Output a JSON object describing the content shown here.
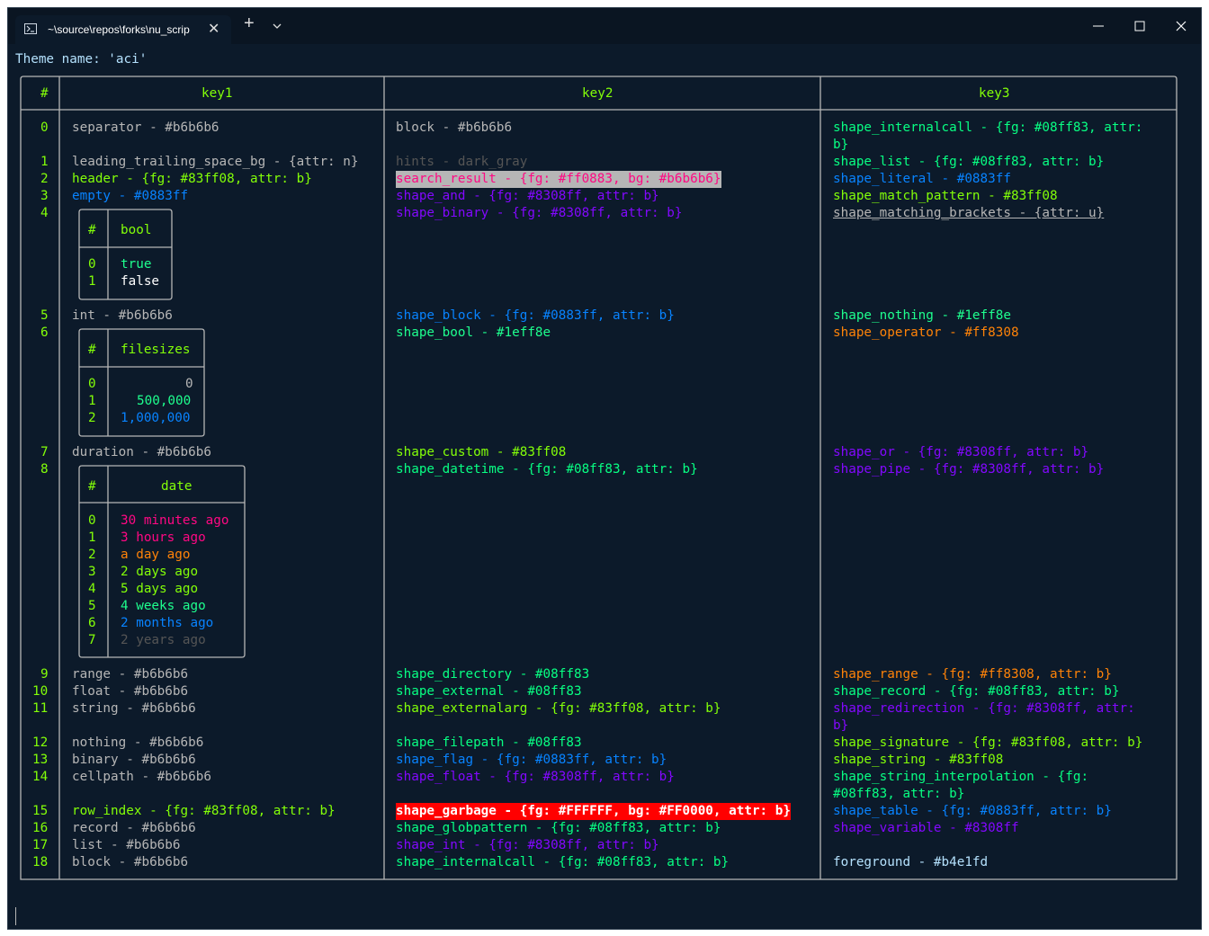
{
  "tab": {
    "title": "~\\source\\repos\\forks\\nu_scrip",
    "close_icon": "close-icon",
    "shell_icon": "powershell-icon"
  },
  "toolbar": {
    "new_tab_icon": "plus-icon",
    "dropdown_icon": "chevron-down-icon"
  },
  "window_controls": {
    "minimize": "minimize-icon",
    "maximize": "maximize-icon",
    "close": "close-icon"
  },
  "theme_line": "Theme name: 'aci'",
  "main_table": {
    "headers": [
      "#",
      "key1",
      "key2",
      "key3"
    ],
    "rows": [
      {
        "i": "0",
        "k1": "separator - #b6b6b6",
        "k2": "block - #b6b6b6",
        "k3a": "shape_internalcall - {fg: #08ff83, attr:",
        "k3b": "b}"
      },
      {
        "i": "1",
        "k1": "leading_trailing_space_bg - {attr: n}",
        "k2": "hints - dark_gray",
        "k3": "shape_list - {fg: #08ff83, attr: b}"
      },
      {
        "i": "2",
        "k1": "header - {fg: #83ff08, attr: b}",
        "k2": "search_result - {fg: #ff0883, bg: #b6b6b6}",
        "k3": "shape_literal - #0883ff"
      },
      {
        "i": "3",
        "k1": "empty - #0883ff",
        "k2": "shape_and - {fg: #8308ff, attr: b}",
        "k3": "shape_match_pattern - #83ff08"
      },
      {
        "i": "4",
        "k2": "shape_binary - {fg: #8308ff, attr: b}",
        "k3": "shape_matching_brackets - {attr: u}"
      },
      {
        "i": "5",
        "k1": "int - #b6b6b6",
        "k2": "shape_block - {fg: #0883ff, attr: b}",
        "k3": "shape_nothing - #1eff8e"
      },
      {
        "i": "6",
        "k2": "shape_bool - #1eff8e",
        "k3": "shape_operator - #ff8308"
      },
      {
        "i": "7",
        "k1": "duration - #b6b6b6",
        "k2": "shape_custom - #83ff08",
        "k3": "shape_or - {fg: #8308ff, attr: b}"
      },
      {
        "i": "8",
        "k2": "shape_datetime - {fg: #08ff83, attr: b}",
        "k3": "shape_pipe - {fg: #8308ff, attr: b}"
      },
      {
        "i": "9",
        "k1": "range - #b6b6b6",
        "k2": "shape_directory - #08ff83",
        "k3": "shape_range - {fg: #ff8308, attr: b}"
      },
      {
        "i": "10",
        "k1": "float - #b6b6b6",
        "k2": "shape_external - #08ff83",
        "k3": "shape_record - {fg: #08ff83, attr: b}"
      },
      {
        "i": "11",
        "k1": "string - #b6b6b6",
        "k2": "shape_externalarg - {fg: #83ff08, attr: b}",
        "k3a": "shape_redirection - {fg: #8308ff, attr:",
        "k3b": "b}"
      },
      {
        "i": "12",
        "k1": "nothing - #b6b6b6",
        "k2": "shape_filepath - #08ff83",
        "k3": "shape_signature - {fg: #83ff08, attr: b}"
      },
      {
        "i": "13",
        "k1": "binary - #b6b6b6",
        "k2": "shape_flag - {fg: #0883ff, attr: b}",
        "k3": "shape_string - #83ff08"
      },
      {
        "i": "14",
        "k1": "cellpath - #b6b6b6",
        "k2": "shape_float - {fg: #8308ff, attr: b}",
        "k3a": "shape_string_interpolation - {fg:",
        "k3b": "#08ff83, attr: b}"
      },
      {
        "i": "15",
        "k1": "row_index - {fg: #83ff08, attr: b}",
        "k2": "shape_garbage - {fg: #FFFFFF, bg: #FF0000, attr: b}",
        "k3": "shape_table - {fg: #0883ff, attr: b}"
      },
      {
        "i": "16",
        "k1": "record - #b6b6b6",
        "k2": "shape_globpattern - {fg: #08ff83, attr: b}",
        "k3": "shape_variable - #8308ff"
      },
      {
        "i": "17",
        "k1": "list - #b6b6b6",
        "k2": "shape_int - {fg: #8308ff, attr: b}"
      },
      {
        "i": "18",
        "k1": "block - #b6b6b6",
        "k2": "shape_internalcall - {fg: #08ff83, attr: b}",
        "k3": "foreground - #b4e1fd"
      }
    ]
  },
  "bool_table": {
    "headers": [
      "#",
      "bool"
    ],
    "rows": [
      {
        "i": "0",
        "v": "true"
      },
      {
        "i": "1",
        "v": "false"
      }
    ]
  },
  "filesizes_table": {
    "headers": [
      "#",
      "filesizes"
    ],
    "rows": [
      {
        "i": "0",
        "v": "0"
      },
      {
        "i": "1",
        "v": "500,000"
      },
      {
        "i": "2",
        "v": "1,000,000"
      }
    ]
  },
  "date_table": {
    "headers": [
      "#",
      "date"
    ],
    "rows": [
      {
        "i": "0",
        "v": "30 minutes ago"
      },
      {
        "i": "1",
        "v": "3 hours ago"
      },
      {
        "i": "2",
        "v": "a day ago"
      },
      {
        "i": "3",
        "v": "2 days ago"
      },
      {
        "i": "4",
        "v": "5 days ago"
      },
      {
        "i": "5",
        "v": "4 weeks ago"
      },
      {
        "i": "6",
        "v": "2 months ago"
      },
      {
        "i": "7",
        "v": "2 years ago"
      }
    ]
  },
  "colors": {
    "background": "#0c1a2a",
    "default": "#b6b6b6",
    "green": "#83ff08",
    "teal": "#08ff83",
    "blue": "#0883ff",
    "purple": "#8308ff",
    "orange": "#ff8308",
    "emerald": "#1eff8e",
    "pink": "#ff0883",
    "foreground": "#b4e1fd",
    "garbage_bg": "#ff0000"
  }
}
